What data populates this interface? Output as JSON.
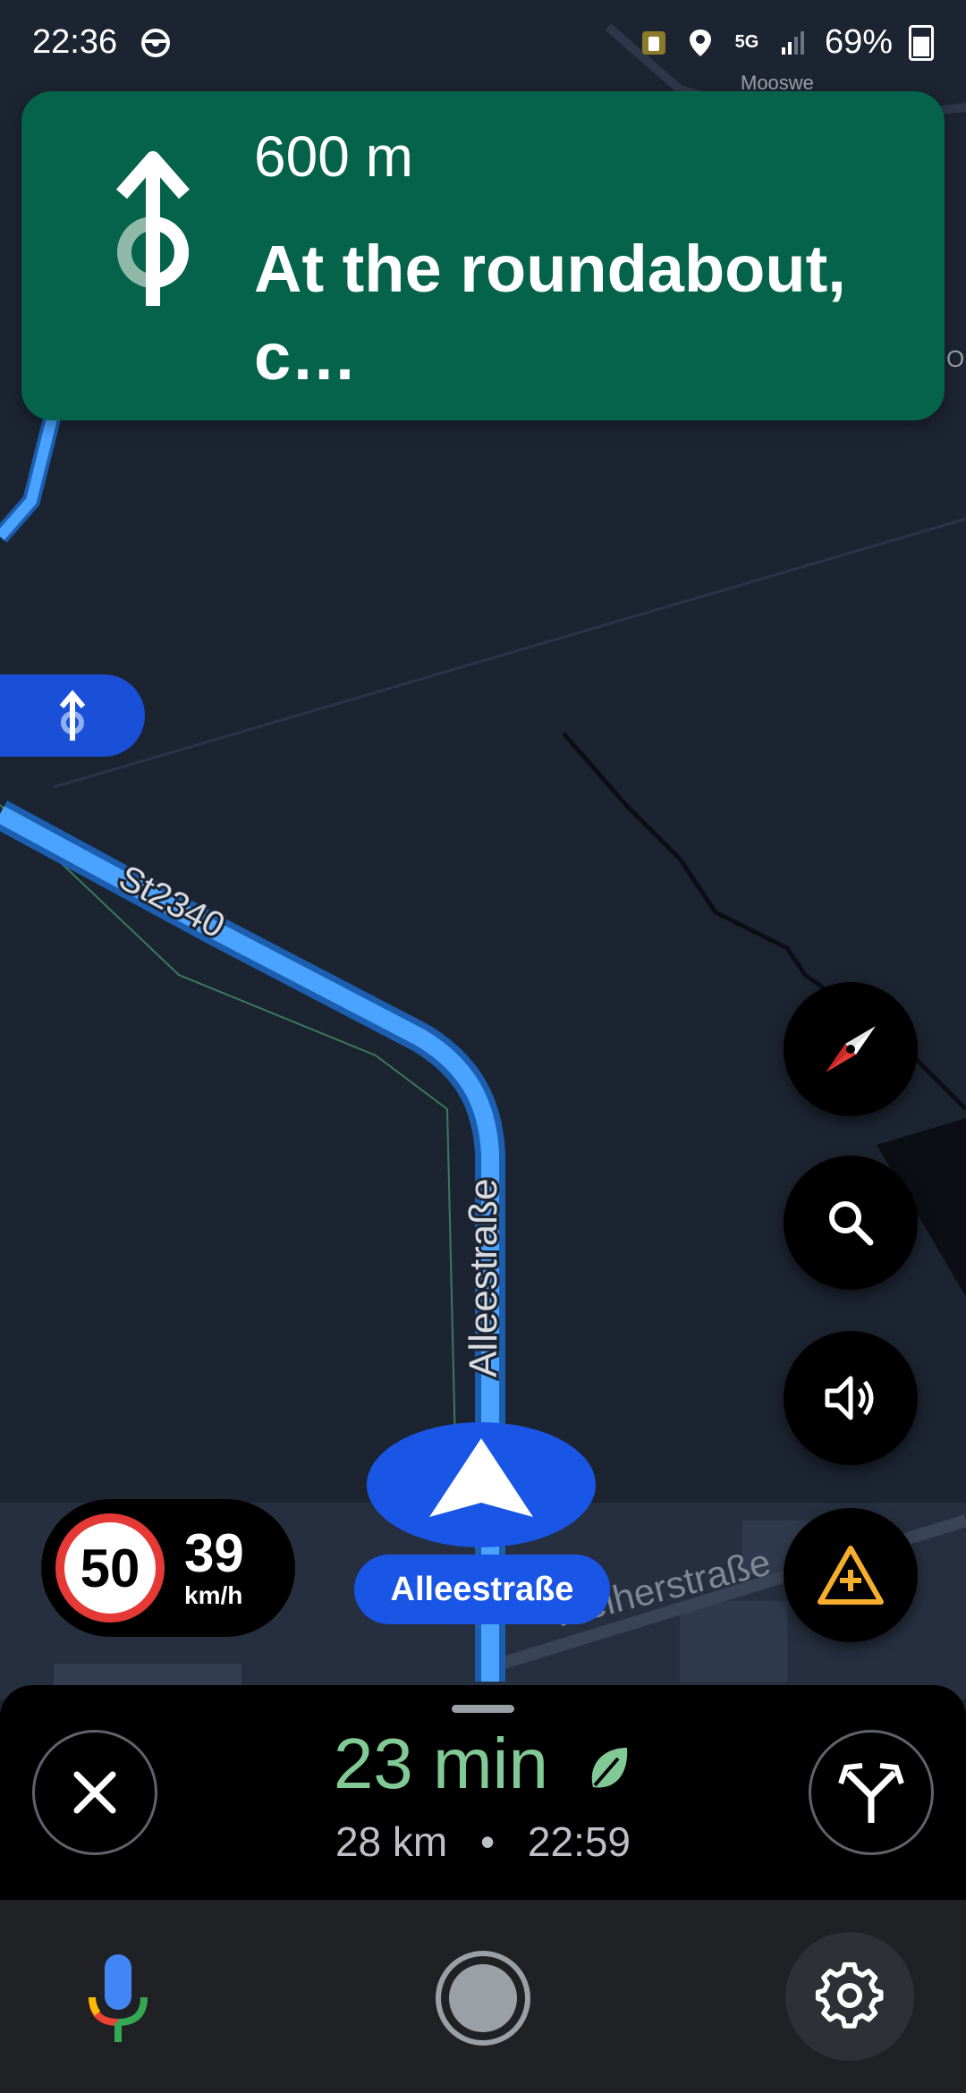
{
  "status_bar": {
    "time": "22:36",
    "network": "5G",
    "battery": "69%"
  },
  "map": {
    "road_labels": [
      "St2340",
      "Alleestraße",
      "Weiherstraße",
      "Mooswe",
      "Oberer"
    ]
  },
  "instruction": {
    "distance": "600 m",
    "text": "At the roundabout, c…",
    "card_color": "#04634a"
  },
  "speed": {
    "limit": "50",
    "current": "39",
    "unit": "km/h"
  },
  "current_street": "Alleestraße",
  "trip": {
    "duration": "23 min",
    "distance": "28 km",
    "separator": "•",
    "arrival": "22:59"
  },
  "colors": {
    "route": "#4aa3ff",
    "eta_green": "#81c995",
    "warning": "#f6ae2d"
  }
}
